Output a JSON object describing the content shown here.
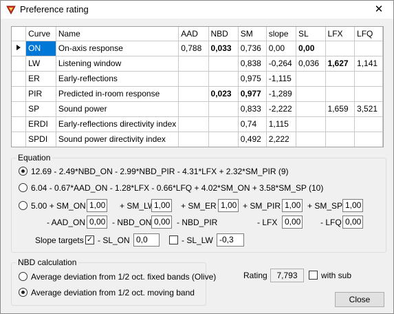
{
  "window": {
    "title": "Preference rating",
    "close_glyph": "✕"
  },
  "grid": {
    "columns": [
      "Curve",
      "Name",
      "AAD",
      "NBD",
      "SM",
      "slope",
      "SL",
      "LFX",
      "LFQ"
    ],
    "rows": [
      {
        "curve": "ON",
        "name": "On-axis response",
        "aad": "0,788",
        "nbd": "0,033",
        "sm": "0,736",
        "slope": "0,00",
        "sl": "0,00",
        "lfx": "",
        "lfq": ""
      },
      {
        "curve": "LW",
        "name": "Listening window",
        "aad": "",
        "nbd": "",
        "sm": "0,838",
        "slope": "-0,264",
        "sl": "0,036",
        "lfx": "1,627",
        "lfq": "1,141"
      },
      {
        "curve": "ER",
        "name": "Early-reflections",
        "aad": "",
        "nbd": "",
        "sm": "0,975",
        "slope": "-1,115",
        "sl": "",
        "lfx": "",
        "lfq": ""
      },
      {
        "curve": "PIR",
        "name": "Predicted in-room response",
        "aad": "",
        "nbd": "0,023",
        "sm": "0,977",
        "slope": "-1,289",
        "sl": "",
        "lfx": "",
        "lfq": ""
      },
      {
        "curve": "SP",
        "name": "Sound power",
        "aad": "",
        "nbd": "",
        "sm": "0,833",
        "slope": "-2,222",
        "sl": "",
        "lfx": "1,659",
        "lfq": "3,521"
      },
      {
        "curve": "ERDI",
        "name": "Early-reflections directivity index",
        "aad": "",
        "nbd": "",
        "sm": "0,74",
        "slope": "1,115",
        "sl": "",
        "lfx": "",
        "lfq": ""
      },
      {
        "curve": "SPDI",
        "name": "Sound power directivity index",
        "aad": "",
        "nbd": "",
        "sm": "0,492",
        "slope": "2,222",
        "sl": "",
        "lfx": "",
        "lfq": ""
      }
    ]
  },
  "equation": {
    "label": "Equation",
    "option1": "12.69 - 2.49*NBD_ON - 2.99*NBD_PIR - 4.31*LFX + 2.32*SM_PIR (9)",
    "option2": "6.04 - 0.67*AAD_ON - 1.28*LFX - 0.66*LFQ + 4.02*SM_ON + 3.58*SM_SP (10)",
    "custom": {
      "const": "5.00 + SM_ON",
      "sm_on": "1,00",
      "sm_lw_label": "+ SM_LW",
      "sm_lw": "1,00",
      "sm_er_label": "+ SM_ER",
      "sm_er": "1,00",
      "sm_pir_label": "+ SM_PIR",
      "sm_pir": "1,00",
      "sm_sp_label": "+ SM_SP",
      "sm_sp": "1,00",
      "aad_on_label": "- AAD_ON",
      "aad_on": "0,00",
      "nbd_on_label": "- NBD_ON",
      "nbd_on": "0,00",
      "nbd_pir_label": "- NBD_PIR",
      "nbd_pir": "0,00",
      "lfx_label": "- LFX",
      "lfx": "0,00",
      "lfq_label": "- LFQ",
      "lfq": "0,00"
    },
    "slope_targets_label": "Slope targets",
    "sl_on_label": "- SL_ON",
    "sl_on": "0,0",
    "sl_lw_label": "- SL_LW",
    "sl_lw": "-0,3"
  },
  "nbd": {
    "label": "NBD calculation",
    "option1": "Average deviation from 1/2 oct. fixed bands (Olive)",
    "option2": "Average deviation from 1/2 oct. moving band"
  },
  "rating": {
    "label": "Rating",
    "value": "7,793",
    "with_sub": "with sub"
  },
  "close_button": "Close",
  "colors": {
    "selection": "#0078d7",
    "title_icon": "#d03020"
  }
}
